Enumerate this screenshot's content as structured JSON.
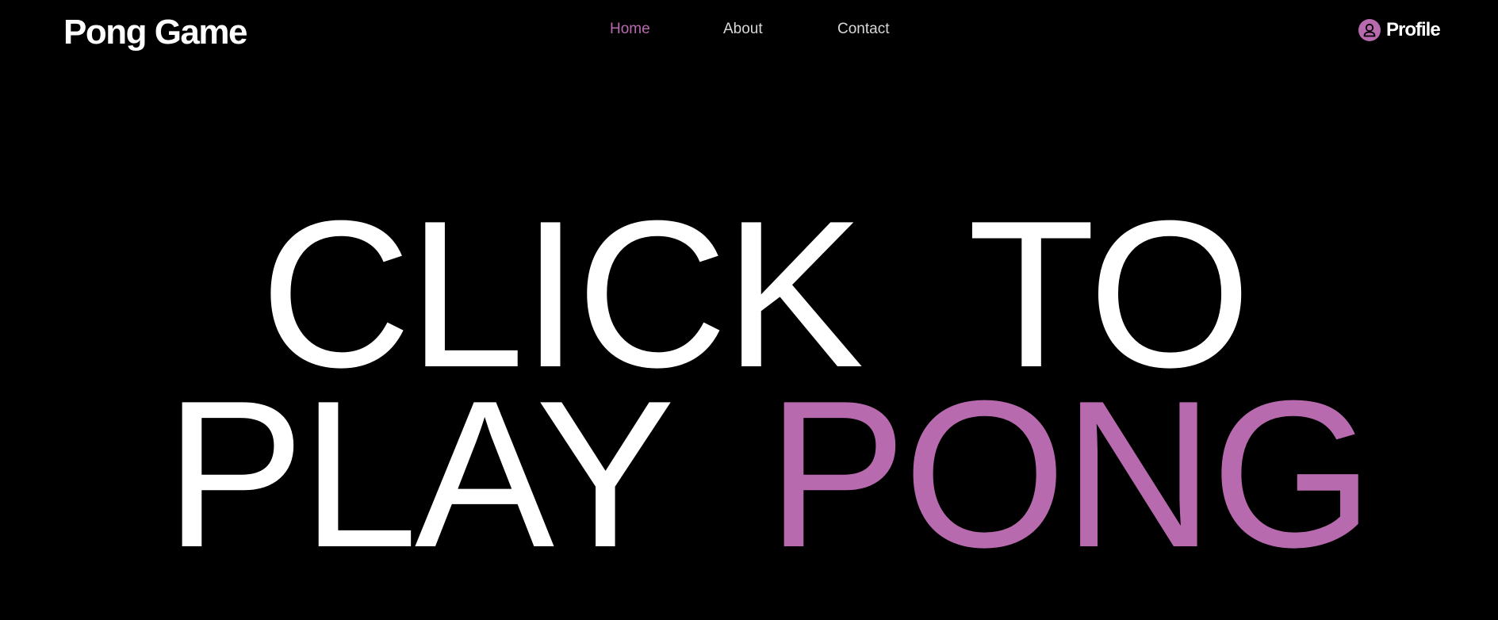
{
  "header": {
    "logo": "Pong Game",
    "nav": [
      {
        "label": "Home",
        "active": true
      },
      {
        "label": "About",
        "active": false
      },
      {
        "label": "Contact",
        "active": false
      }
    ],
    "profile": {
      "label": "Profile",
      "icon": "user-icon"
    }
  },
  "hero": {
    "line1": {
      "word1": "CLICK",
      "word2": "TO"
    },
    "line2": {
      "word1": "PLAY",
      "word2": "PONG"
    }
  },
  "colors": {
    "background": "#000000",
    "text": "#ffffff",
    "accent": "#b86aae",
    "nav_text": "#d9d9d9"
  }
}
